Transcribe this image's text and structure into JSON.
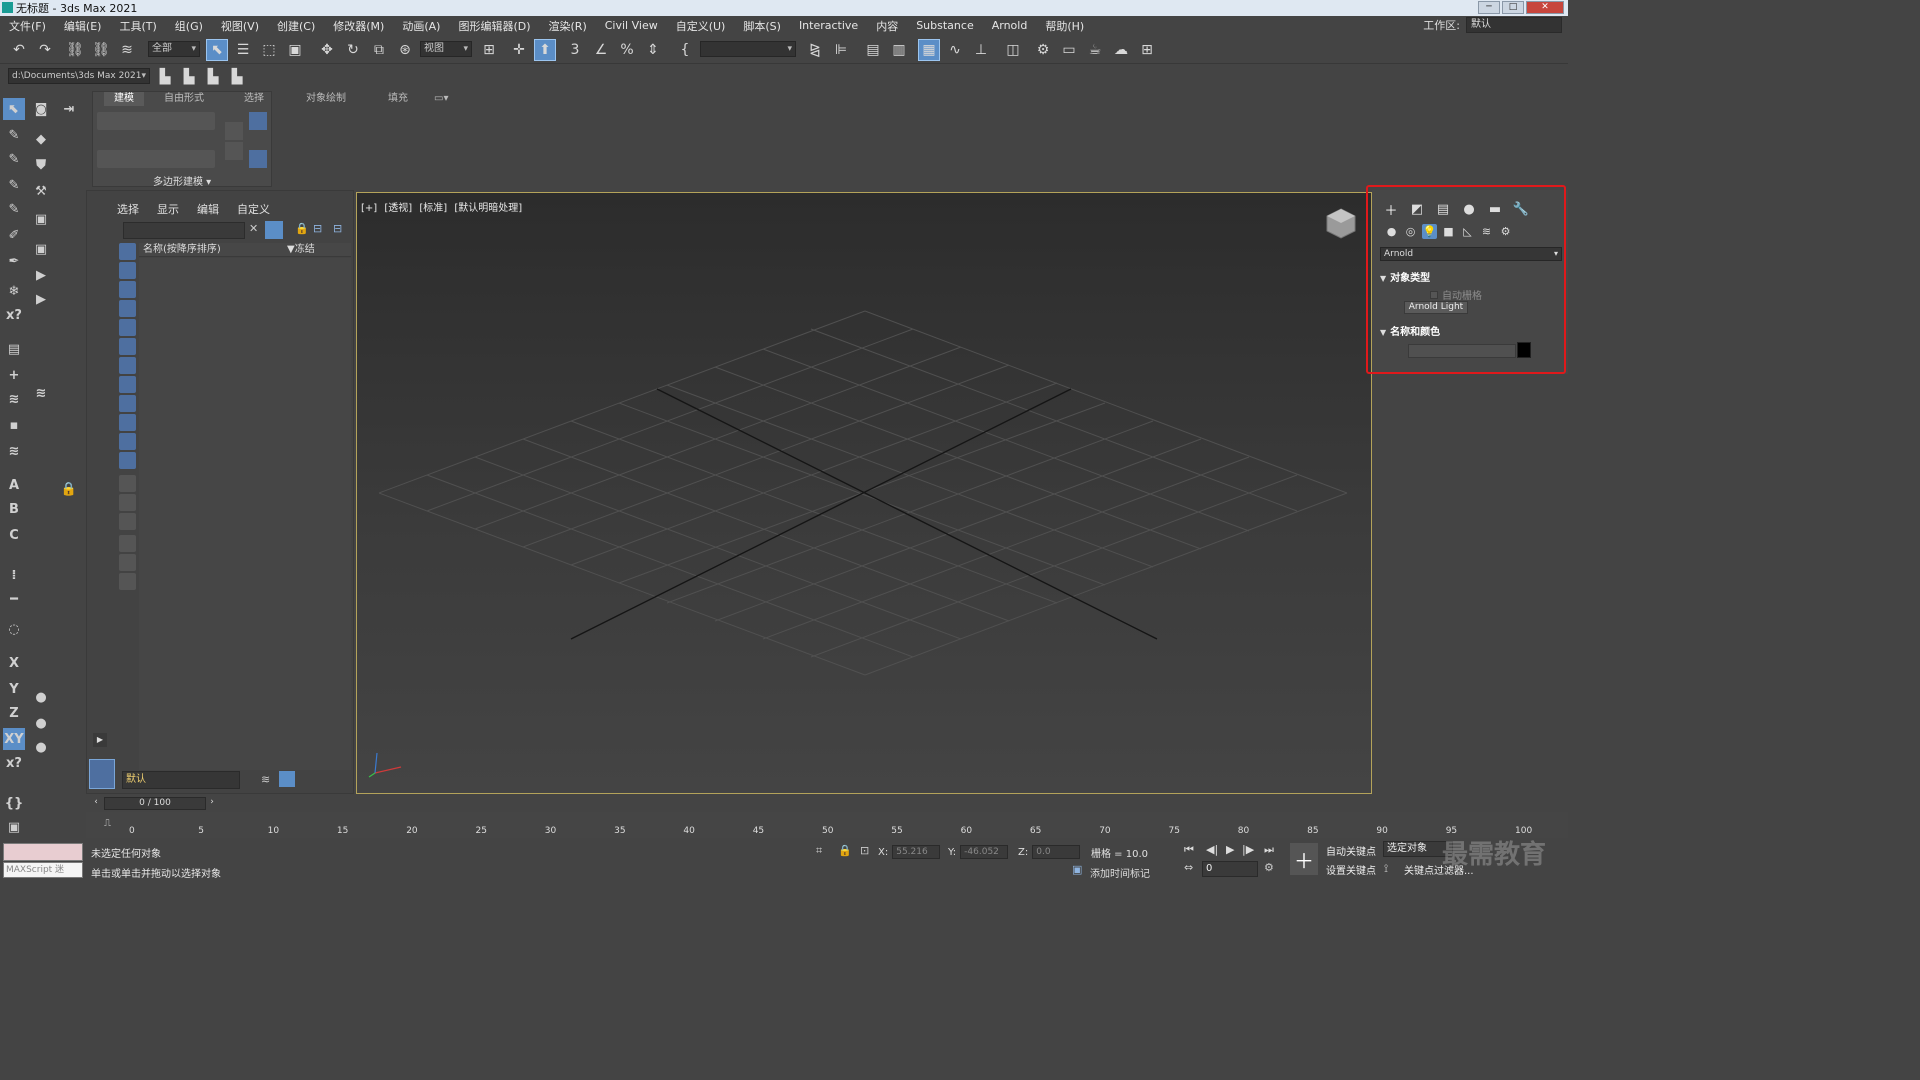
{
  "window": {
    "title": "无标题 - 3ds Max 2021",
    "min": "─",
    "max": "□",
    "close": "✕"
  },
  "menu": [
    "文件(F)",
    "编辑(E)",
    "工具(T)",
    "组(G)",
    "视图(V)",
    "创建(C)",
    "修改器(M)",
    "动画(A)",
    "图形编辑器(D)",
    "渲染(R)",
    "Civil View",
    "自定义(U)",
    "脚本(S)",
    "Interactive",
    "内容",
    "Substance",
    "Arnold",
    "帮助(H)"
  ],
  "workspace": {
    "label": "工作区:",
    "value": "默认"
  },
  "toolbar": {
    "selection_filter": "全部",
    "ref_coord": "视图",
    "named_sel": ""
  },
  "toolbar2": {
    "path": "d:\\Documents\\3ds Max 2021"
  },
  "ribbon": {
    "tabs": [
      "建模",
      "自由形式",
      "选择",
      "对象绘制",
      "填充"
    ],
    "panel_label": "多边形建模 ▾"
  },
  "scene_explorer": {
    "tabs": [
      "选择",
      "显示",
      "编辑",
      "自定义"
    ],
    "col_name": "名称(按降序排序)",
    "col_freeze": "▼冻结",
    "layer": "默认"
  },
  "viewport": {
    "labels": [
      "[+]",
      "[透视]",
      "[标准]",
      "[默认明暗处理]"
    ]
  },
  "command_panel": {
    "renderer": "Arnold",
    "rollout1": "对象类型",
    "autogrid": "自动栅格",
    "button": "Arnold Light",
    "rollout2": "名称和颜色",
    "color": "#000000",
    "highlight": "#e0191b"
  },
  "timeline": {
    "slider": "0 / 100",
    "ticks": [
      "0",
      "5",
      "10",
      "15",
      "20",
      "25",
      "30",
      "35",
      "40",
      "45",
      "50",
      "55",
      "60",
      "65",
      "70",
      "75",
      "80",
      "85",
      "90",
      "95",
      "100"
    ]
  },
  "status": {
    "maxscript": "MAXScript 迷",
    "line1": "未选定任何对象",
    "line2": "单击或单击并拖动以选择对象",
    "x_label": "X:",
    "x": "55.216",
    "y_label": "Y:",
    "y": "-46.052",
    "z_label": "Z:",
    "z": "0.0",
    "grid": "栅格 = 10.0",
    "add_time": "添加时间标记",
    "auto_key": "自动关键点",
    "set_key": "设置关键点",
    "selected": "选定对象",
    "key_filter": "关键点过滤器...",
    "frame": "0"
  },
  "watermark": "最需教育"
}
